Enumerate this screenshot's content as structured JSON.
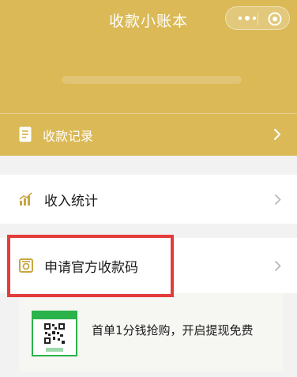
{
  "header": {
    "title": "收款小账本",
    "capsule": {
      "more_icon": "more-dots-icon",
      "close_icon": "target-circle-icon"
    },
    "background": "#dab956"
  },
  "records": {
    "label": "收款记录",
    "icon": "document-icon"
  },
  "menu": {
    "income_stats": {
      "label": "收入统计",
      "icon": "bar-chart-icon"
    },
    "apply_code": {
      "label": "申请官方收款码",
      "icon": "receipt-code-icon"
    }
  },
  "promo": {
    "text": "首单1分钱抢购，开启提现免费",
    "image": "qr-code-card"
  },
  "colors": {
    "accent": "#dab956",
    "highlight": "#e43b3b",
    "qr_green": "#2ab34a"
  }
}
